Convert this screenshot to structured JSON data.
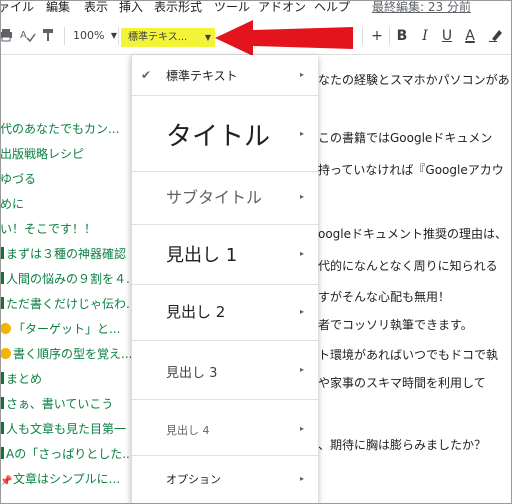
{
  "menubar": {
    "items": [
      "ァイル",
      "編集",
      "表示",
      "挿入",
      "表示形式",
      "ツール",
      "アドオン",
      "ヘルプ"
    ],
    "last_edited": "最終編集: 23 分前"
  },
  "toolbar": {
    "zoom": "100%",
    "style_value": "標準テキス...",
    "plus": "+",
    "bold": "B",
    "italic": "I",
    "underline": "U",
    "text_color": "A",
    "highlight_color": "#f3f33a",
    "arrow_color": "#e3141c"
  },
  "outline": {
    "items": [
      "代のあなたでもカン...",
      "出版戦略レシピ",
      "ゆづる",
      "めに",
      "い！そこです！！",
      "まずは３種の神器確認",
      "人間の悩みの９割を４...",
      "ただ書くだけじゃ伝わ...",
      "「ターゲット」と...",
      "書く順序の型を覚え...",
      "まとめ",
      "さぁ、書いていこう",
      "人も文章も見た目第一",
      "Aの「さっぱりとした...",
      "文章はシンプルに..."
    ]
  },
  "document": {
    "lines": [
      "なたの経験とスマホかパソコンがあ",
      "この書籍ではGoogleドキュメン",
      "持っていなければ『Googleアカウ",
      "oogleドキュメント推奨の理由は、",
      "代的になんとなく周りに知られる",
      "すがそんな心配も無用！",
      "者でコッソリ執筆できます。",
      "ト環境があればいつでもドコで執",
      "や家事のスキマ時間を利用して",
      "、期待に胸は膨らみましたか？"
    ]
  },
  "dropdown": {
    "items": [
      {
        "label": "標準テキスト"
      },
      {
        "label": "タイトル"
      },
      {
        "label": "サブタイトル"
      },
      {
        "label": "見出し 1"
      },
      {
        "label": "見出し 2"
      },
      {
        "label": "見出し 3"
      },
      {
        "label": "見出し 4"
      },
      {
        "label": "オプション"
      }
    ],
    "checkmark": "✔",
    "chevron": "▸"
  }
}
